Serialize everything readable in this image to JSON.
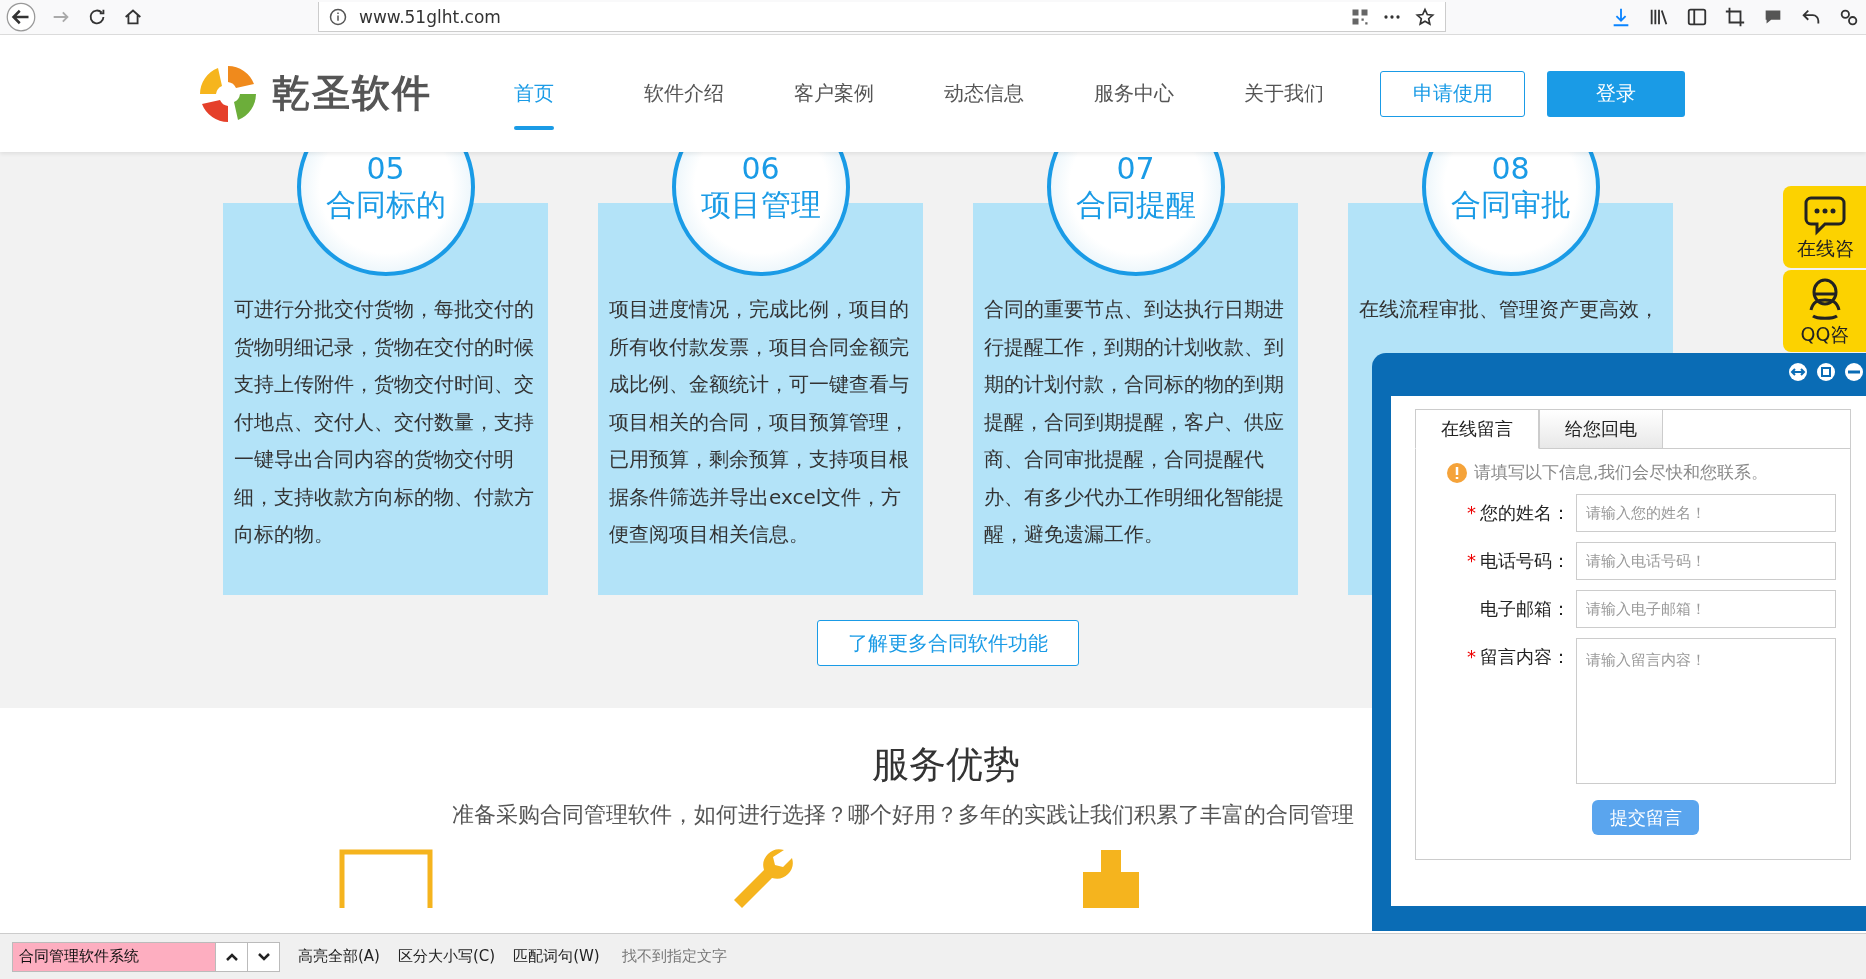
{
  "browser": {
    "url": "www.51glht.com"
  },
  "header": {
    "logo_text": "乾圣软件",
    "nav": [
      {
        "label": "首页",
        "selected": true
      },
      {
        "label": "软件介绍",
        "selected": false
      },
      {
        "label": "客户案例",
        "selected": false
      },
      {
        "label": "动态信息",
        "selected": false
      },
      {
        "label": "服务中心",
        "selected": false
      },
      {
        "label": "关于我们",
        "selected": false
      }
    ],
    "apply_button": "申请使用",
    "login_button": "登录"
  },
  "features": [
    {
      "number": "05",
      "title": "合同标的",
      "text": "可进行分批交付货物，每批交付的货物明细记录，货物在交付的时候支持上传附件，货物交付时间、交付地点、交付人、交付数量，支持一键导出合同内容的货物交付明细，支持收款方向标的物、付款方向标的物。"
    },
    {
      "number": "06",
      "title": "项目管理",
      "text": "项目进度情况，完成比例，项目的所有收付款发票，项目合同金额完成比例、金额统计，可一键查看与项目相关的合同，项目预算管理，已用预算，剩余预算，支持项目根据条件筛选并导出excel文件，方便查阅项目相关信息。"
    },
    {
      "number": "07",
      "title": "合同提醒",
      "text": "合同的重要节点、到达执行日期进行提醒工作，到期的计划收款、到期的计划付款，合同标的物的到期提醒，合同到期提醒，客户、供应商、合同审批提醒，合同提醒代办、有多少代办工作明细化智能提醒，避免遗漏工作。"
    },
    {
      "number": "08",
      "title": "合同审批",
      "text": "在线流程审批、管理资产更高效，"
    }
  ],
  "more_button": "了解更多合同软件功能",
  "services": {
    "title": "服务优势",
    "subtitle": "准备采购合同管理软件，如何进行选择？哪个好用？多年的实践让我们积累了丰富的合同管理"
  },
  "side_float": [
    {
      "kind": "chat",
      "label": "在线咨"
    },
    {
      "kind": "qq",
      "label": "QQ咨"
    }
  ],
  "chat_panel": {
    "tabs": [
      {
        "label": "在线留言",
        "selected": true
      },
      {
        "label": "给您回电",
        "selected": false
      }
    ],
    "required_mark": "*",
    "notice": "请填写以下信息,我们会尽快和您联系。",
    "fields": [
      {
        "label": "您的姓名：",
        "required": true,
        "kind": "input",
        "placeholder": "请输入您的姓名！"
      },
      {
        "label": "电话号码：",
        "required": true,
        "kind": "input",
        "placeholder": "请输入电话号码！"
      },
      {
        "label": "电子邮箱：",
        "required": false,
        "kind": "input",
        "placeholder": "请输入电子邮箱！"
      },
      {
        "label": "留言内容：",
        "required": true,
        "kind": "textarea",
        "placeholder": "请输入留言内容！"
      }
    ],
    "submit": "提交留言"
  },
  "find_bar": {
    "value": "合同管理软件系统",
    "not_found": true,
    "options": [
      "高亮全部(A)",
      "区分大小写(C)",
      "匹配词句(W)"
    ],
    "status": "找不到指定文字"
  }
}
